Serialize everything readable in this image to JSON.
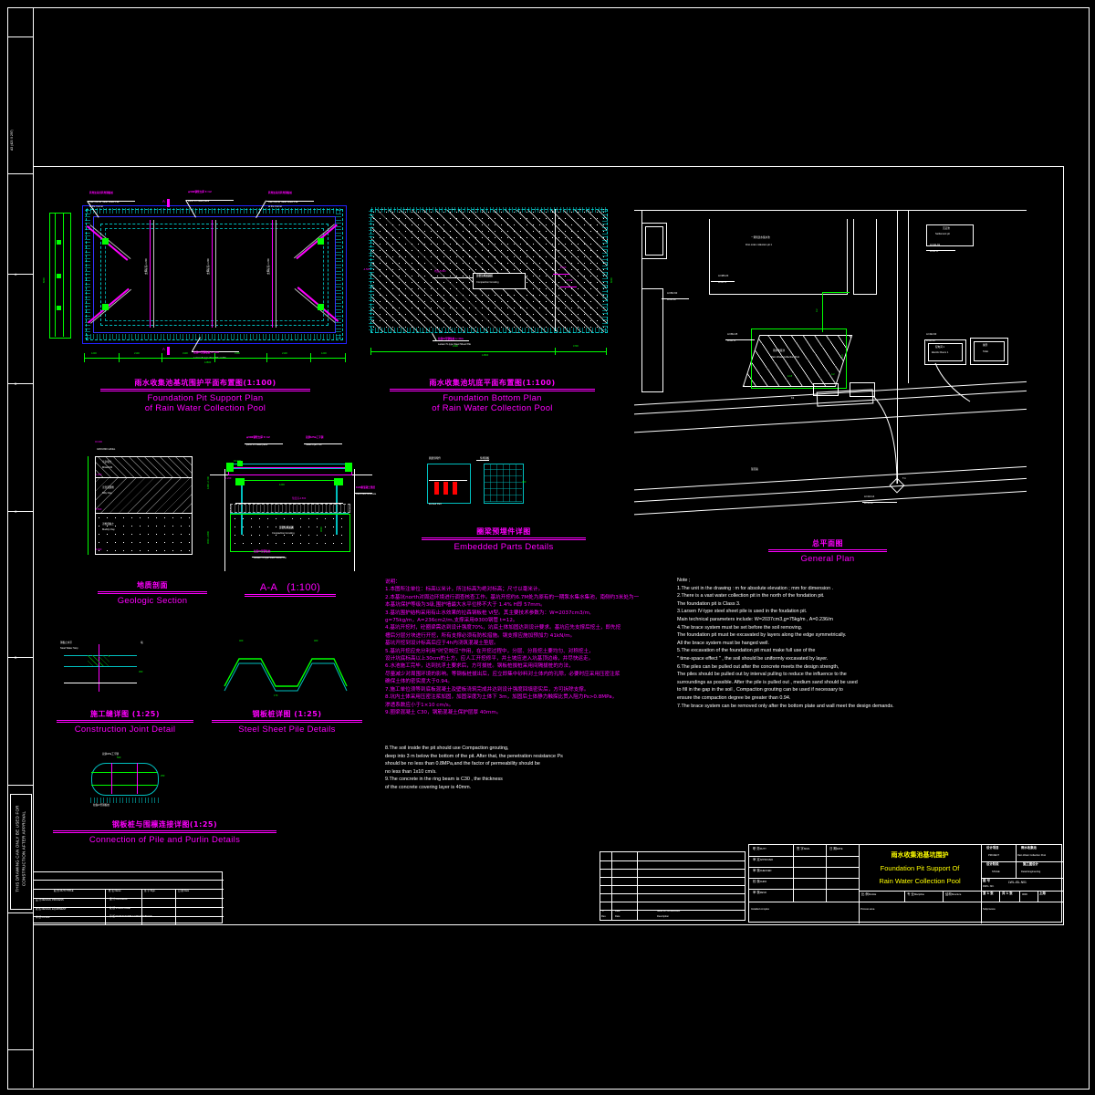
{
  "sheet": {
    "vertical_note": "THIS DRAWING CAN ONLY BE USED FOR CONSTRUCTION AFTER APPROVAL"
  },
  "drawings": [
    {
      "id": "pit-support-plan",
      "title_cn": "雨水收集池基坑围护平面布置图",
      "title_en_1": "Foundation Pit Support Plan",
      "title_en_2": "of Rain Water Collection Pool",
      "scale": "(1:100)",
      "callouts": [
        {
          "cn": "转角处采用转角钢板桩",
          "en_1": "Use Corner Steel Sheet Pile",
          "en_2": "at the Corner"
        },
        {
          "cn": "φ300钢管支撑 t=12",
          "en_1": "φ300 PO steel parts",
          "en_2": ""
        },
        {
          "cn": "转角处采用转角钢板桩",
          "en_1": "Use Corner Steel Sheet Pile",
          "en_2": "at the Corner"
        },
        {
          "cn": "拉森Ⅳ型钢板桩  L=9m",
          "en_1": "Larsen IV-type Steel Sheet Pile",
          "en_2": ""
        }
      ],
      "section_marks": [
        "A",
        "A"
      ],
      "inner_labels": [
        "支撑标高-1.200",
        "支撑标高-1.200",
        "支撑标高-1.200"
      ],
      "dimensions_bottom": [
        "1200",
        "2100",
        "3100",
        "3100",
        "2100",
        "1200"
      ],
      "dimension_total": "12800"
    },
    {
      "id": "foundation-bottom-plan",
      "title_cn": "雨水收集池坑底平面布置图",
      "title_en_1": "Foundation Bottom Plan",
      "title_en_2": "of Rain Water Collection Pool",
      "scale": "(1:100)",
      "callouts": [
        {
          "cn": "压密注浆加固区",
          "en_1": "Compaction Grouting",
          "en_2": ""
        },
        {
          "cn": "拉森Ⅳ型钢板桩  L=9m",
          "en_1": "Larsen IV-type Steel Sheet Pile",
          "en_2": ""
        }
      ],
      "dimensions_bottom": [
        "1600",
        "4700"
      ],
      "dimension_total": "12800",
      "side_dims": [
        "1600",
        "6000"
      ]
    },
    {
      "id": "geologic-section",
      "title_cn": "地质剖面",
      "title_en_1": "Geologic Section",
      "title_en_2": "",
      "scale": "",
      "layers": [
        {
          "name": "GROUND LEVEL",
          "elev": "±0.000"
        },
        {
          "name": "②杂填土 Mixed Fill",
          "elev": "-1.200"
        },
        {
          "name": "③淤泥质粉质黏土 Silty Clay",
          "elev": "-3.500"
        },
        {
          "name": "④粉质黏土 Muddy Clay",
          "elev": "-6.000"
        }
      ]
    },
    {
      "id": "section-a-a",
      "title_cn": "",
      "title_en_1": "A-A",
      "title_en_2": "",
      "scale": "(1:100)",
      "callouts": [
        {
          "cn": "φ300钢管支撑 t=12",
          "en_1": "φ300 PO steel parts",
          "en_2": ""
        },
        {
          "cn": "双拼I25a工字钢",
          "en_1": "Steel Pipe t=12",
          "en_2": ""
        },
        {
          "cn": "C20素混凝土垫层",
          "en_1": "C20 Pure Concrete",
          "en_2": ""
        },
        {
          "cn": "压密注浆加固",
          "en_1": "Compaction Grouting",
          "en_2": ""
        },
        {
          "cn": "拉森Ⅳ型钢板桩",
          "en_1": "Larsen IV-type Steel Sheet Pile",
          "en_2": ""
        }
      ],
      "elevations": [
        "±0.000",
        "-1.200",
        "-4.500",
        "-5.500"
      ],
      "dims": [
        "1200",
        "2700",
        "4500"
      ]
    },
    {
      "id": "embedded-parts-details",
      "title_cn": "圈梁预埋件详图",
      "title_en_1": "Embedded Parts Details",
      "title_en_2": "",
      "scale": ""
    },
    {
      "id": "construction-joint-detail",
      "title_cn": "施工缝详图",
      "title_en_1": "Construction Joint Detail",
      "title_en_2": "",
      "scale": "(1:25)"
    },
    {
      "id": "steel-sheet-pile-details",
      "title_cn": "钢板桩详图",
      "title_en_1": "Steel Sheet Pile Details",
      "title_en_2": "",
      "scale": "(1:25)"
    },
    {
      "id": "connection-pile-purlin-details",
      "title_cn": "钢板桩与围檩连接详图",
      "title_en_1": "Connection of Pile and Purlin Details",
      "title_en_2": "",
      "scale": "(1:25)"
    },
    {
      "id": "general-plan",
      "title_cn": "总平面图",
      "title_en_1": "General Plan",
      "title_en_2": "",
      "scale": "",
      "labels": [
        {
          "cn": "一期泵送水集水池",
          "en": "First order collection pit 1"
        },
        {
          "cn": "雨水收集池",
          "en": "Rain Water Collection Pool"
        },
        {
          "cn": "沉淀池",
          "en": "Settlement pit"
        },
        {
          "cn": "配电间 1",
          "en": "Electric Room 1"
        },
        {
          "cn": "厕所",
          "en": "Toilet"
        },
        {
          "cn": "现况路",
          "en": ""
        }
      ],
      "coords": [
        {
          "a": "A=352.60",
          "b": "B=84.20"
        },
        {
          "a": "A=352.25",
          "b": "B=80.57"
        },
        {
          "a": "A=389.20",
          "b": "B=80.57"
        },
        {
          "a": "A=411.63",
          "b": "B=84.57"
        },
        {
          "a": "A=432.00",
          "b": "B=80.25"
        },
        {
          "a": "A=413.14",
          "b": "B=51.21"
        }
      ],
      "dims": [
        "12.8",
        "6.0",
        "3.2",
        "4.2"
      ]
    }
  ],
  "notes_cn": {
    "heading": "说明：",
    "lines": [
      "1.本图所注单位：标高以米计，所注标高为绝对标高；尺寸以毫米计。",
      "2.本基坑north对周边环境进行调查核查工作。基坑开挖约6.7M处为原有的一期泵水集水集池，南侧约3米处为一",
      "   本基坑保护等级为3级,围护墙最大水平位移不大于 1.4% H即 57mm。",
      "3.基坑围护结构采用有止水效果的拉森钢板桩 Ⅵ型。其主要技术参数为：W=2037cm3/m,",
      "   g=75kg/m，A=236cm2/m,支撑采用Φ300钢管 t=12。",
      "4.基坑开挖时，砼圈梁需达到设计强度70%，坑底土体加固达到设计要求。基坑应先支撑后挖土，即先挖",
      "   槽后分层分块进行开挖，所有支撑必须有防松措施。钢支撑应施加预加力 41kN/m。",
      "   基坑开挖到设计标高后应于4h内浇筑混凝土垫层。",
      "5.基坑开挖应充分利用\"时空效应\"作用，在开挖过程中，分层、分段挖土要均匀、对称挖土，",
      "   设计坑底标高以上30cm的土方，应人工开挖修平，并土坡应进入坑基顶边缘，并尽快运走。",
      "6.水池施工完毕，达到抗浮土要求后，方可拔桩。钢板桩拔桩采用间隔拔桩的方法，",
      "   尽量减少对周围环境的影响。等钢板桩拔出后，应立即集中砂料对土体内的孔隙，必要时应采用压密注浆",
      "   确保土体的密实度大于0.94。",
      "7.施工单位须等到底板混凝土及壁板浇筑完成并达到设计强度回填密实后，方可拆除支撑。",
      "8.坑内土体采用压密注浆加固，加固深度为土体下 3m，加固后土体静力触探比贯入阻力Ps>0.8MPa，",
      "   渗透系数应小于1×10  cm/s。",
      "9.圈梁混凝土 C30，钢筋混凝土保护层厚 40mm。"
    ]
  },
  "notes_en": {
    "heading": "Note ;",
    "lines": [
      "1.The unit in the drawing : m for absolute elevation ; mm for dimension .",
      "2.There is a vast water collection pit in the north of the fondation pit.",
      "   The foundation pit is Class 3.",
      "3.Larsen IV-type steel sheet pile is used in the foudation pit.",
      "   Main technical parameters include: W=2037cm3,g=75kg/m , A=0.236/m",
      "4.The brace system must be set before the soil removing.",
      "   The foundation pit must be excavated by layers along the edge symmetrically.",
      "   All the brace system must be hanged well.",
      "5.The excavation of the foundation pit must make full use of the",
      "\" time-space effect \" , the soil should be uniformly excavated by layer.",
      "6.The piles can be pulled out after the concrete meets the design strength,",
      "   The piles should be pulled out by interval pulling to reduce the influence to the",
      "   surroundings as possible. After the pile is pulled out , medium sand should be used",
      "   to fill in the gap in the soil , Compaction grouting can be used if necessary to",
      "   ensure the compaction degree be greater than 0.94.",
      "7.The brace system can be removed only after the bottom plate and wall meet the design demands."
    ]
  },
  "notes_en_extra": {
    "lines": [
      "8.The soil inside the pit should use Compaction grouting,",
      "   deep into 3 m below the bottom of the pit. After that,  the penetration resistance Ps",
      "   should be no less than 0.8MPa,and the factor of permeability should be",
      "   no less than 1x10  cm/s.",
      "9.The concrete in the ring beam is C30 , the thickness",
      "   of the concrete covering layer is 40mm."
    ]
  },
  "revision_table": {
    "columns": [
      "0",
      "Date",
      "Issue for Construction"
    ],
    "footer": [
      "Rev.",
      "Date",
      "Description"
    ]
  },
  "approval_table": {
    "rows": [
      {
        "cn": "审 定",
        "en": "APPROVED"
      },
      {
        "cn": "审 核",
        "en": "CHECKED"
      },
      {
        "cn": "校 核",
        "en": "CHKD"
      },
      {
        "cn": "审 核",
        "en": "REVD"
      },
      {
        "cn": "审 定",
        "en": "APPR"
      }
    ],
    "headers": [
      {
        "cn": "职 务",
        "en": "DUTY"
      },
      {
        "cn": "签 字",
        "en": "SIGN."
      },
      {
        "cn": "日 期",
        "en": "DATE"
      }
    ]
  },
  "title_block": {
    "drawing_title_cn": "雨水收集池基坑围护",
    "drawing_title_en_1": "Foundation Pit Support Of",
    "drawing_title_en_2": "Rain Water Collection Pool",
    "scale_label_cn": "比 例",
    "scale_label_en": "SCALE",
    "scale_value": "",
    "discipline_label_cn": "专 业",
    "discipline_label_en": "Discipline",
    "structure_label_cn": "结构",
    "structure_label_en": "Structure",
    "project_label_cn": "设计项目",
    "project_label_en": "PROJECT",
    "project_value_cn": "雨水收集池",
    "project_value_en": "Rain Water Collection Pool",
    "subproject_label_cn": "设计阶段",
    "subproject_label_en": "STAGE",
    "subproject_value_cn": "施工图设计",
    "subproject_value_en": "Detail Engineering",
    "dwg_no_label_cn": "图 号",
    "dwg_no_label_en": "DWG. NO.",
    "dwg_no_value": "LWL-t3L-N01",
    "sheet_label_cn": "第 1 张",
    "sheet_total_cn": "共 1 张",
    "rev_value": "0000",
    "rev_label": "上海",
    "installed_complex": "Installed complex",
    "process_area": "Process area",
    "subprocess": "Subprocess"
  },
  "bottom_left_table": {
    "header": {
      "cn": "职 务",
      "en": "DUTY/TITLE",
      "name_cn": "姓 名",
      "name_en": "Name",
      "sign_cn": "签 字",
      "sign_en": "Sign.",
      "date_cn": "日 期",
      "date_en": "Date"
    },
    "rows": [
      {
        "cn": "设 计",
        "en": "DESIGN, PROCESS"
      },
      {
        "cn": "校 核",
        "en": "DESIGN, EQUIPMENT"
      },
      {
        "cn": "审 核",
        "en": "PIPING"
      },
      {
        "cn": "审 定",
        "en": "CIVIL (Structural & Instruments)"
      },
      {
        "cn": "总 负 责",
        "en": "E&I (Electrical & Instruments)"
      }
    ],
    "right_rows": [
      {
        "cn": "设 计",
        "en": "PROCESS"
      },
      {
        "cn": "校 核",
        "en": "STRUCTURE"
      },
      {
        "cn": "审 核",
        "en": "WATER SUPPLY AND DRAINAGE"
      }
    ]
  },
  "colors": {
    "cyan": "#00ffff",
    "green": "#00ff00",
    "magenta": "#ff00ff",
    "white": "#ffffff",
    "yellow": "#ffff00",
    "blue": "#0000ff"
  }
}
